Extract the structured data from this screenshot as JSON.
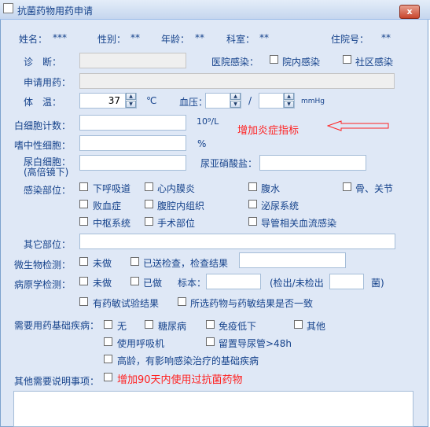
{
  "window": {
    "title": "抗菌药物用药申请",
    "close_label": "x"
  },
  "patient": {
    "name_label": "姓名：",
    "name_value": "***",
    "gender_label": "性别：",
    "gender_value": "**",
    "age_label": "年龄：",
    "age_value": "**",
    "dept_label": "科室：",
    "dept_value": "**",
    "inpatient_label": "住院号：",
    "inpatient_value": "**"
  },
  "diagnosis": {
    "label": "诊　断："
  },
  "hospital_infection": {
    "label": "医院感染：",
    "option1": "院内感染",
    "option2": "社区感染"
  },
  "requested_drug": {
    "label": "申请用药："
  },
  "temperature": {
    "label": "体　温：",
    "value": "37",
    "unit": "℃"
  },
  "blood_pressure": {
    "label": "血压：",
    "separator": "/",
    "unit": "mmHg"
  },
  "wbc": {
    "label": "白细胞计数：",
    "unit": "10⁹/L"
  },
  "annotation": {
    "text": "增加炎症指标"
  },
  "neutrophil": {
    "label": "嗜中性细胞：",
    "unit": "%"
  },
  "urine_wbc": {
    "label_line1": "尿白细胞：",
    "label_line2": "(高倍镜下)"
  },
  "nitrite": {
    "label": "尿亚硝酸盐："
  },
  "infection_site": {
    "label": "感染部位：",
    "options": [
      "下呼吸道",
      "心内膜炎",
      "腹水",
      "骨、关节",
      "败血症",
      "腹腔内组织",
      "泌尿系统",
      "中枢系统",
      "手术部位",
      "导管相关血流感染"
    ]
  },
  "other_site": {
    "label": "其它部位："
  },
  "micro_test": {
    "label": "微生物检测：",
    "option1": "未做",
    "option2": "已送检查，检查结果"
  },
  "pathogen_test": {
    "label": "病原学检测：",
    "option1": "未做",
    "option2": "已做",
    "specimen_label": "标本：",
    "detect_label": "(检出/未检出",
    "bacteria_label": "菌)",
    "option3": "有药敏试验结果",
    "option4": "所选药物与药敏结果是否一致"
  },
  "basic_disease": {
    "label": "需要用药基础疾病：",
    "options": [
      "无",
      "糖尿病",
      "免疫低下",
      "其他",
      "使用呼吸机",
      "留置导尿管>48h",
      "高龄，有影响感染治疗的基础疾病"
    ]
  },
  "other_notes": {
    "label": "其他需要说明事项：",
    "annotation": "增加90天内使用过抗菌药物"
  }
}
